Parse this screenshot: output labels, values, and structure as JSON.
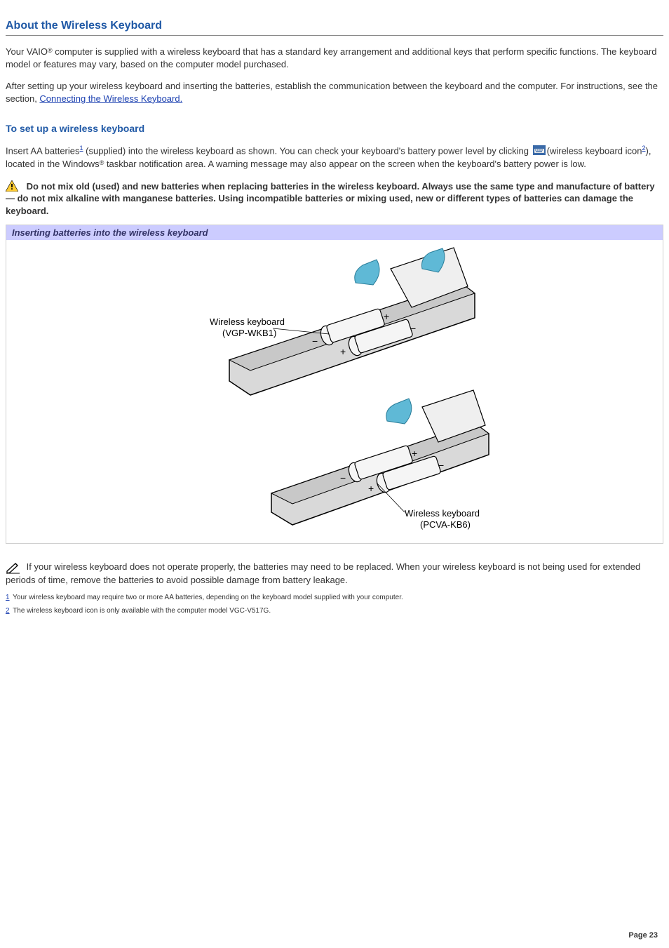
{
  "title": "About the Wireless Keyboard",
  "intro_para_1a": "Your VAIO",
  "reg": "®",
  "intro_para_1b": " computer is supplied with a wireless keyboard that has a standard key arrangement and additional keys that perform specific functions. The keyboard model or features may vary, based on the computer model purchased.",
  "intro_para_2a": "After setting up your wireless keyboard and inserting the batteries, establish the communication between the keyboard and the computer. For instructions, see the section, ",
  "intro_link": "Connecting the Wireless Keyboard.",
  "subhead": "To set up a wireless keyboard",
  "setup_a": "Insert AA batteries",
  "sup1": "1",
  "setup_b": " (supplied) into the wireless keyboard as shown. You can check your keyboard's battery power level by clicking ",
  "setup_c": "(wireless keyboard icon",
  "sup2": "2",
  "setup_d": "), located in the Windows",
  "setup_e": " taskbar notification area. A warning message may also appear on the screen when the keyboard's battery power is low.",
  "warning_text": "Do not mix old (used) and new batteries when replacing batteries in the wireless keyboard. Always use the same type and manufacture of battery — do not mix alkaline with manganese batteries. Using incompatible batteries or mixing used, new or different types of batteries can damage the keyboard.",
  "figure_caption": "Inserting batteries into the wireless keyboard",
  "fig_label_1a": "Wireless keyboard",
  "fig_label_1b": "(VGP-WKB1)",
  "fig_label_2a": "Wireless keyboard",
  "fig_label_2b": "(PCVA-KB6)",
  "note_text": "If your wireless keyboard does not operate properly, the batteries may need to be replaced. When your wireless keyboard is not being used for extended periods of time, remove the batteries to avoid possible damage from battery leakage.",
  "footnote1_ref": "1",
  "footnote1_text": " Your wireless keyboard may require two or more AA batteries, depending on the keyboard model supplied with your computer.",
  "footnote2_ref": "2",
  "footnote2_text": " The wireless keyboard icon is only available with the computer model VGC-V517G.",
  "page_number": "Page 23"
}
